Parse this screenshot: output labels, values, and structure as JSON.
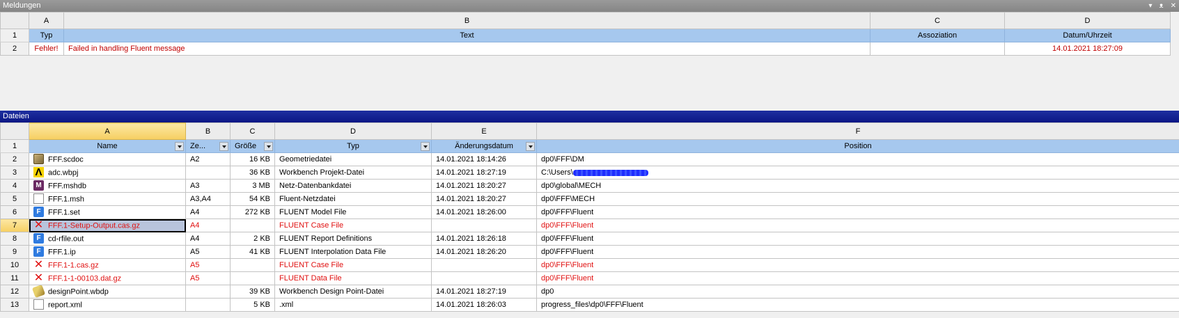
{
  "messages_panel": {
    "title": "Meldungen",
    "controls": [
      "▾",
      "ᴥ",
      "✕"
    ],
    "columns": [
      "A",
      "B",
      "C",
      "D"
    ],
    "row_numbers": [
      "1",
      "2"
    ],
    "headers": [
      "Typ",
      "Text",
      "Assoziation",
      "Datum/Uhrzeit"
    ],
    "rows": [
      {
        "typ": "Fehler!",
        "text": "Failed in handling Fluent message",
        "assoziation": "",
        "datum": "14.01.2021 18:27:09"
      }
    ]
  },
  "files_panel": {
    "title": "Dateien",
    "columns": [
      "A",
      "B",
      "C",
      "D",
      "E",
      "F"
    ],
    "headers": [
      "Name",
      "Ze...",
      "Größe",
      "Typ",
      "Änderungsdatum",
      "Position"
    ],
    "rows": [
      {
        "n": "2",
        "icon": "geometry-icon",
        "name": "FFF.scdoc",
        "ze": "A2",
        "size": "16 KB",
        "typ": "Geometriedatei",
        "date": "14.01.2021 18:14:26",
        "pos": "dp0\\FFF\\DM",
        "error": false
      },
      {
        "n": "3",
        "icon": "workbench-icon",
        "name": "adc.wbpj",
        "ze": "",
        "size": "36 KB",
        "typ": "Workbench Projekt-Datei",
        "date": "14.01.2021 18:27:19",
        "pos": "C:\\Users\\",
        "error": false
      },
      {
        "n": "4",
        "icon": "mesh-db-icon",
        "name": "FFF.mshdb",
        "ze": "A3",
        "size": "3 MB",
        "typ": "Netz-Datenbankdatei",
        "date": "14.01.2021 18:20:27",
        "pos": "dp0\\global\\MECH",
        "error": false
      },
      {
        "n": "5",
        "icon": "file-icon",
        "name": "FFF.1.msh",
        "ze": "A3,A4",
        "size": "54 KB",
        "typ": "Fluent-Netzdatei",
        "date": "14.01.2021 18:20:27",
        "pos": "dp0\\FFF\\MECH",
        "error": false
      },
      {
        "n": "6",
        "icon": "fluent-icon",
        "name": "FFF.1.set",
        "ze": "A4",
        "size": "272 KB",
        "typ": "FLUENT Model File",
        "date": "14.01.2021 18:26:00",
        "pos": "dp0\\FFF\\Fluent",
        "error": false
      },
      {
        "n": "7",
        "icon": "missing-file-icon",
        "name": "FFF.1-Setup-Output.cas.gz",
        "ze": "A4",
        "size": "",
        "typ": "FLUENT Case File",
        "date": "",
        "pos": "dp0\\FFF\\Fluent",
        "error": true
      },
      {
        "n": "8",
        "icon": "fluent-icon",
        "name": "cd-rfile.out",
        "ze": "A4",
        "size": "2 KB",
        "typ": "FLUENT Report Definitions",
        "date": "14.01.2021 18:26:18",
        "pos": "dp0\\FFF\\Fluent",
        "error": false
      },
      {
        "n": "9",
        "icon": "fluent-icon",
        "name": "FFF.1.ip",
        "ze": "A5",
        "size": "41 KB",
        "typ": "FLUENT Interpolation Data File",
        "date": "14.01.2021 18:26:20",
        "pos": "dp0\\FFF\\Fluent",
        "error": false
      },
      {
        "n": "10",
        "icon": "missing-file-icon",
        "name": "FFF.1-1.cas.gz",
        "ze": "A5",
        "size": "",
        "typ": "FLUENT Case File",
        "date": "",
        "pos": "dp0\\FFF\\Fluent",
        "error": true
      },
      {
        "n": "11",
        "icon": "missing-file-icon",
        "name": "FFF.1-1-00103.dat.gz",
        "ze": "A5",
        "size": "",
        "typ": "FLUENT Data File",
        "date": "",
        "pos": "dp0\\FFF\\Fluent",
        "error": true
      },
      {
        "n": "12",
        "icon": "design-point-icon",
        "name": "designPoint.wbdp",
        "ze": "",
        "size": "39 KB",
        "typ": "Workbench Design Point-Datei",
        "date": "14.01.2021 18:27:19",
        "pos": "dp0",
        "error": false
      },
      {
        "n": "13",
        "icon": "file-icon",
        "name": "report.xml",
        "ze": "",
        "size": "5 KB",
        "typ": ".xml",
        "date": "14.01.2021 18:26:03",
        "pos": "progress_files\\dp0\\FFF\\Fluent",
        "error": false
      }
    ]
  },
  "colors": {
    "error_text": "#e01010",
    "field_header": "#a6c8ee",
    "files_titlebar": "#0b1785",
    "selected_column": "#f6cf62"
  }
}
